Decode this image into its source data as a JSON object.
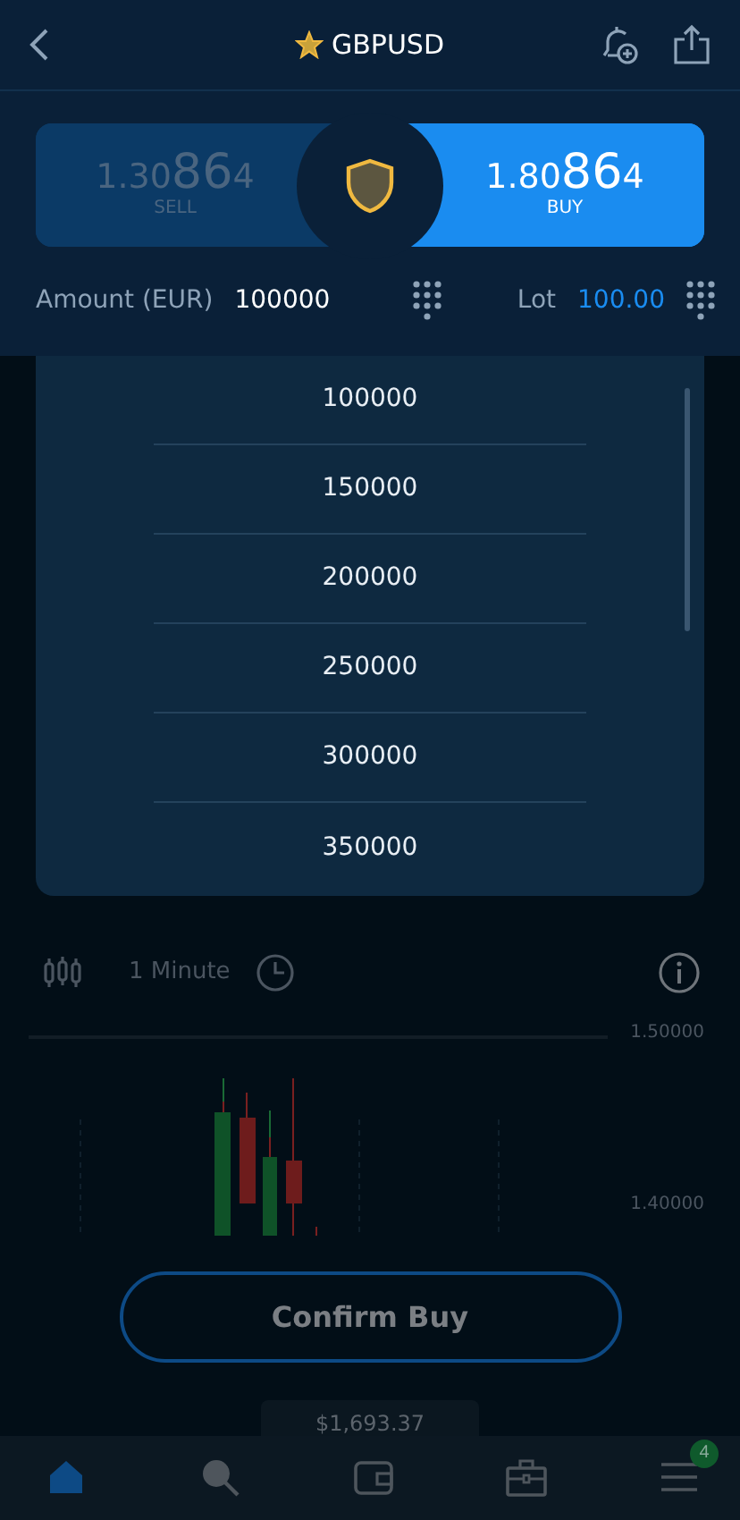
{
  "header": {
    "title": "GBPUSD",
    "favorite": true
  },
  "quote": [
    {
      "kind": "sell",
      "price_start": "1.30",
      "price_big": "86",
      "price_end": "4",
      "label": "SELL",
      "selected": false
    },
    {
      "kind": "buy",
      "price_start": "1.80",
      "price_big": "86",
      "price_end": "4",
      "label": "BUY",
      "selected": true
    }
  ],
  "order": {
    "amount_label": "Amount (EUR)",
    "amount_value": "100000",
    "lot_label": "Lot",
    "lot_value": "100.00"
  },
  "amount_dropdown": {
    "options": [
      "100000",
      "150000",
      "200000",
      "250000",
      "300000",
      "350000"
    ]
  },
  "chart": {
    "timeframe": "1 Minute",
    "y_labels": [
      "1.50000",
      "1.40000"
    ]
  },
  "confirm_button": "Confirm Buy",
  "balance": "$1,693.37",
  "nav": [
    {
      "kind": "home",
      "selected": true
    },
    {
      "kind": "search",
      "selected": false
    },
    {
      "kind": "wallet",
      "selected": false
    },
    {
      "kind": "briefcase",
      "selected": false
    },
    {
      "kind": "menu",
      "selected": false,
      "badge": "4"
    }
  ]
}
